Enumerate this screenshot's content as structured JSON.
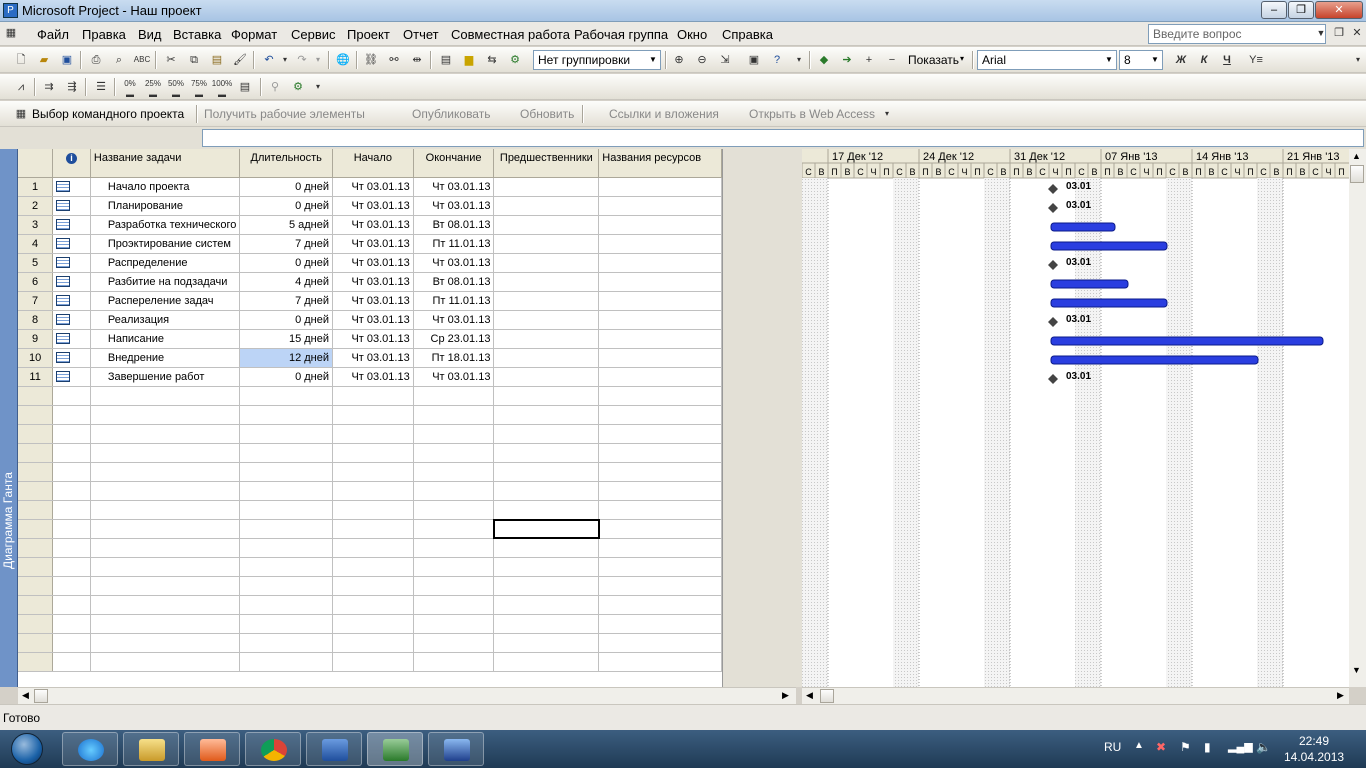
{
  "window": {
    "title": "Microsoft Project - Наш проект"
  },
  "menu": {
    "items": [
      "Файл",
      "Правка",
      "Вид",
      "Вставка",
      "Формат",
      "Сервис",
      "Проект",
      "Отчет",
      "Совместная работа",
      "Рабочая группа",
      "Окно",
      "Справка"
    ],
    "help_placeholder": "Введите вопрос"
  },
  "toolbar": {
    "grouping": "Нет группировки",
    "show": "Показать",
    "font": "Arial",
    "size": "8",
    "bold": "Ж",
    "italic": "К",
    "underline": "Ч",
    "pct": [
      "0%",
      "25%",
      "50%",
      "75%",
      "100%"
    ]
  },
  "team": {
    "select_project": "Выбор командного проекта",
    "get_work": "Получить рабочие элементы",
    "publish": "Опубликовать",
    "refresh": "Обновить",
    "links": "Ссылки и вложения",
    "web_access": "Открыть в Web Access"
  },
  "view_bar": {
    "label": "Диаграмма Ганта"
  },
  "table": {
    "headers": {
      "indicators": "i",
      "name": "Название задачи",
      "duration": "Длительность",
      "start": "Начало",
      "finish": "Окончание",
      "predecessors": "Предшественники",
      "resources": "Названия ресурсов"
    },
    "rows": [
      {
        "id": "1",
        "name": "Начало проекта",
        "duration": "0 дней",
        "start": "Чт 03.01.13",
        "finish": "Чт 03.01.13",
        "milestone": true,
        "days": 0
      },
      {
        "id": "2",
        "name": "Планирование",
        "duration": "0 дней",
        "start": "Чт 03.01.13",
        "finish": "Чт 03.01.13",
        "milestone": true,
        "days": 0
      },
      {
        "id": "3",
        "name": "Разработка технического",
        "duration": "5 адней",
        "start": "Чт 03.01.13",
        "finish": "Вт 08.01.13",
        "milestone": false,
        "days": 5
      },
      {
        "id": "4",
        "name": "Проэктирование систем",
        "duration": "7 дней",
        "start": "Чт 03.01.13",
        "finish": "Пт 11.01.13",
        "milestone": false,
        "days": 9
      },
      {
        "id": "5",
        "name": "Распределение",
        "duration": "0 дней",
        "start": "Чт 03.01.13",
        "finish": "Чт 03.01.13",
        "milestone": true,
        "days": 0
      },
      {
        "id": "6",
        "name": "Разбитие на подзадачи",
        "duration": "4 дней",
        "start": "Чт 03.01.13",
        "finish": "Вт 08.01.13",
        "milestone": false,
        "days": 6
      },
      {
        "id": "7",
        "name": "Распереление задач",
        "duration": "7 дней",
        "start": "Чт 03.01.13",
        "finish": "Пт 11.01.13",
        "milestone": false,
        "days": 9
      },
      {
        "id": "8",
        "name": "Реализация",
        "duration": "0 дней",
        "start": "Чт 03.01.13",
        "finish": "Чт 03.01.13",
        "milestone": true,
        "days": 0
      },
      {
        "id": "9",
        "name": "Написание",
        "duration": "15 дней",
        "start": "Чт 03.01.13",
        "finish": "Ср 23.01.13",
        "milestone": false,
        "days": 21
      },
      {
        "id": "10",
        "name": "Внедрение",
        "duration": "12 дней",
        "start": "Чт 03.01.13",
        "finish": "Пт 18.01.13",
        "milestone": false,
        "days": 16
      },
      {
        "id": "11",
        "name": "Завершение работ",
        "duration": "0 дней",
        "start": "Чт 03.01.13",
        "finish": "Чт 03.01.13",
        "milestone": true,
        "days": 0
      }
    ]
  },
  "gantt": {
    "weeks": [
      "17 Дек '12",
      "24 Дек '12",
      "31 Дек '12",
      "07 Янв '13",
      "14 Янв '13",
      "21 Янв '13"
    ],
    "day_letters": [
      "С",
      "В",
      "П",
      "В",
      "С",
      "Ч",
      "П"
    ],
    "milestone_label": "03.01",
    "bar_color": "#2a3ee0"
  },
  "status": {
    "text": "Готово"
  },
  "tray": {
    "lang": "RU",
    "time": "22:49",
    "date": "14.04.2013"
  }
}
